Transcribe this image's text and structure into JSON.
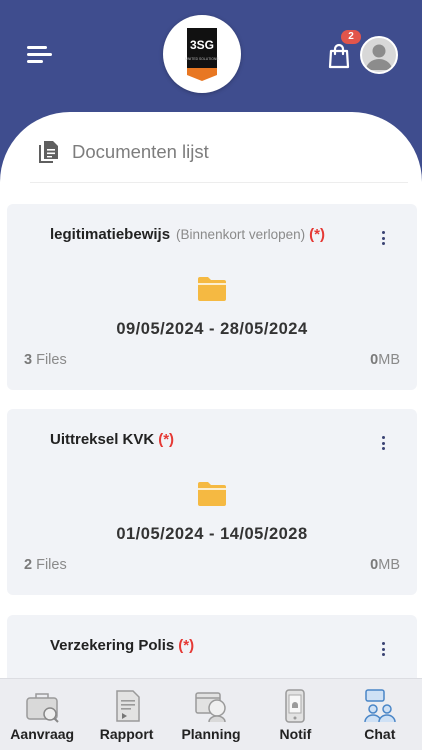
{
  "header": {
    "cart_badge": "2",
    "logo_text": "3SG",
    "logo_subtext": "UNITED SOLUTIONS"
  },
  "page": {
    "title": "Documenten lijst"
  },
  "documents": [
    {
      "title": "legitimatiebewijs",
      "note": "(Binnenkort verlopen)",
      "required": "(*)",
      "dates": "09/05/2024 - 28/05/2024",
      "files_count": "3",
      "files_label": " Files",
      "size_value": "0",
      "size_unit": "MB"
    },
    {
      "title": "Uittreksel KVK",
      "note": "",
      "required": "(*)",
      "dates": "01/05/2024 - 14/05/2028",
      "files_count": "2",
      "files_label": " Files",
      "size_value": "0",
      "size_unit": "MB"
    },
    {
      "title": "Verzekering Polis",
      "note": "",
      "required": "(*)"
    }
  ],
  "nav": {
    "items": [
      {
        "label": "Aanvraag",
        "icon": "briefcase-icon"
      },
      {
        "label": "Rapport",
        "icon": "report-icon"
      },
      {
        "label": "Planning",
        "icon": "planning-icon"
      },
      {
        "label": "Notif",
        "icon": "notification-icon"
      },
      {
        "label": "Chat",
        "icon": "chat-icon"
      }
    ]
  },
  "colors": {
    "header_bg": "#3f4d8e",
    "folder": "#f5b942",
    "required": "#e53935",
    "badge": "#e2554b",
    "card_bg": "#f1f3f7",
    "active_nav_icon": "#4a86c7"
  }
}
